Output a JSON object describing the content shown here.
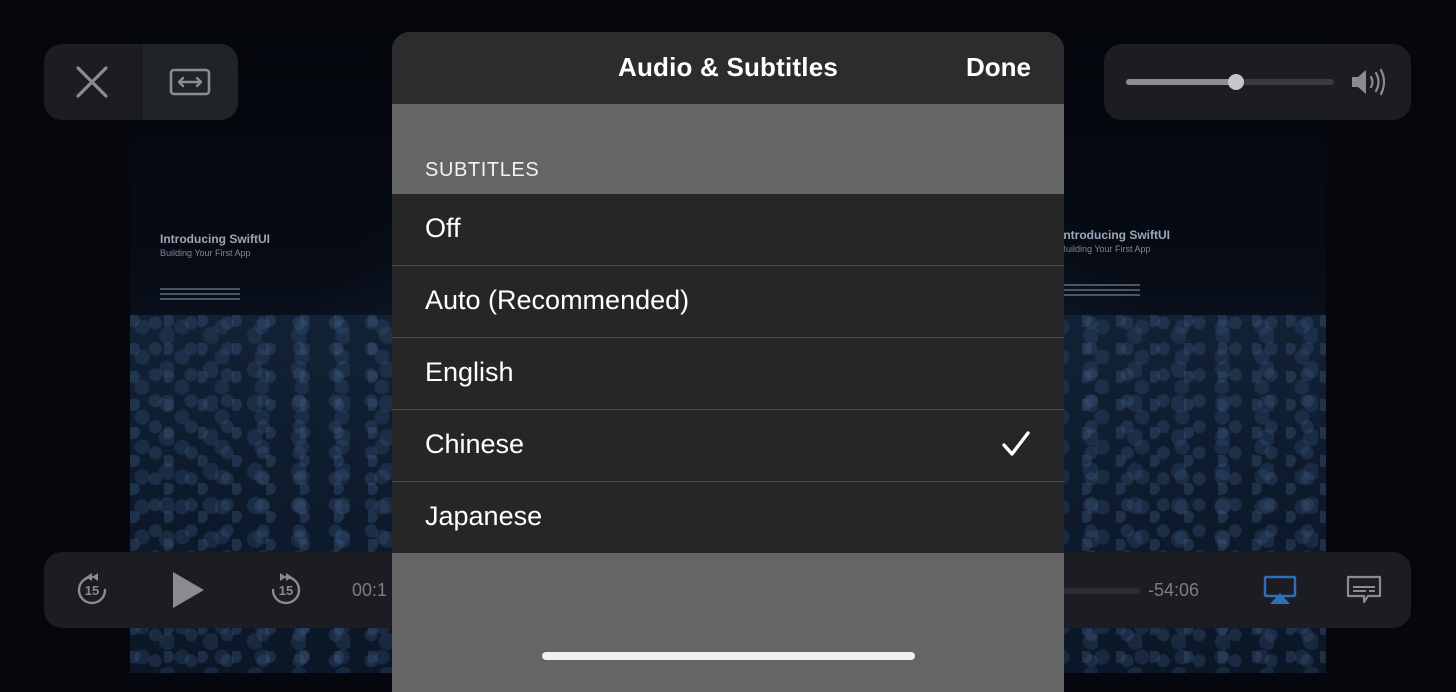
{
  "sheet": {
    "title": "Audio & Subtitles",
    "done_label": "Done",
    "section_header": "SUBTITLES",
    "options": [
      {
        "label": "Off",
        "selected": false
      },
      {
        "label": "Auto (Recommended)",
        "selected": false
      },
      {
        "label": "English",
        "selected": false
      },
      {
        "label": "Chinese",
        "selected": true
      },
      {
        "label": "Japanese",
        "selected": false
      }
    ]
  },
  "video": {
    "slide_title": "Introducing SwiftUI",
    "slide_subtitle": "Building Your First App"
  },
  "player": {
    "elapsed_time_partial": "00:1",
    "remaining_time": "-54:06",
    "skip_back_seconds": "15",
    "skip_forward_seconds": "15",
    "volume_level": 0.53,
    "icons": {
      "close": "close-icon",
      "aspect": "aspect-ratio-icon",
      "volume": "speaker-icon",
      "skip_back": "skip-back-15-icon",
      "play": "play-icon",
      "skip_forward": "skip-forward-15-icon",
      "airplay": "airplay-icon",
      "subtitles": "subtitles-icon"
    },
    "colors": {
      "airplay_accent": "#2f6fb5"
    }
  }
}
